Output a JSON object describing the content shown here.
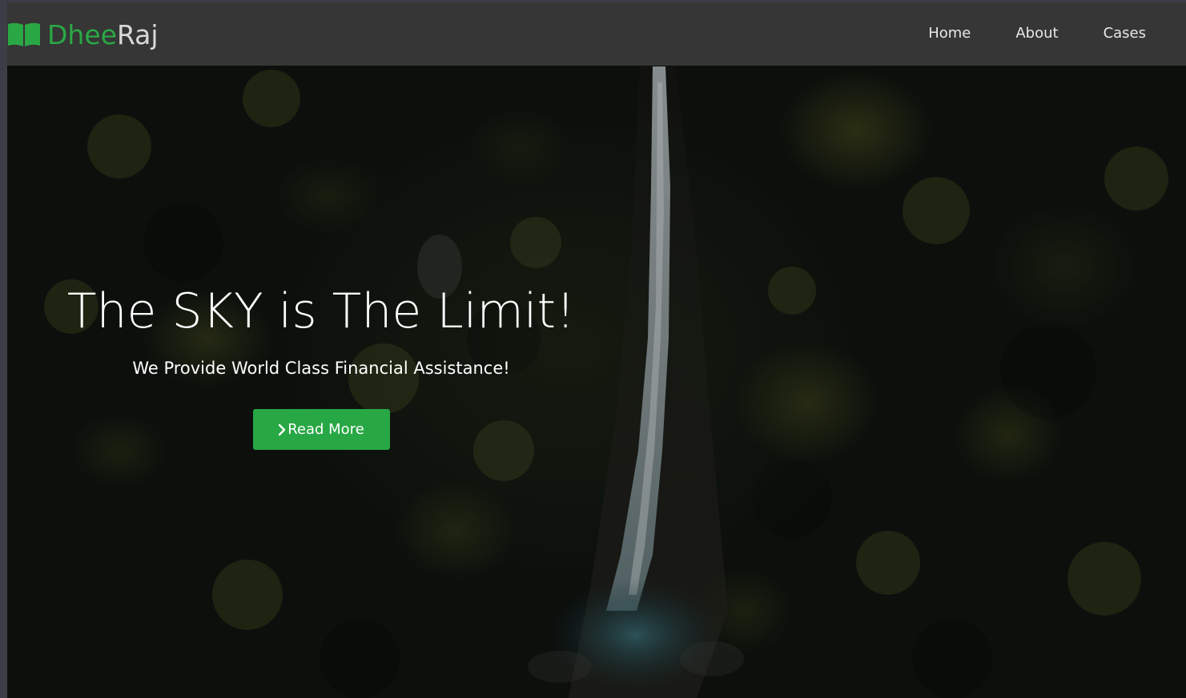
{
  "brand": {
    "name_part1": "Dhee",
    "name_part2": "Raj",
    "icon": "open-book-icon",
    "accent_color": "#2aa845"
  },
  "nav": {
    "items": [
      {
        "label": "Home"
      },
      {
        "label": "About"
      },
      {
        "label": "Cases"
      }
    ]
  },
  "hero": {
    "title": "The SKY is The Limit!",
    "subtitle": "We Provide World Class Financial Assistance!",
    "button": {
      "label": "Read More",
      "icon": "chevron-right-icon",
      "color": "#28a745"
    },
    "background": "aerial forest with waterfall"
  }
}
